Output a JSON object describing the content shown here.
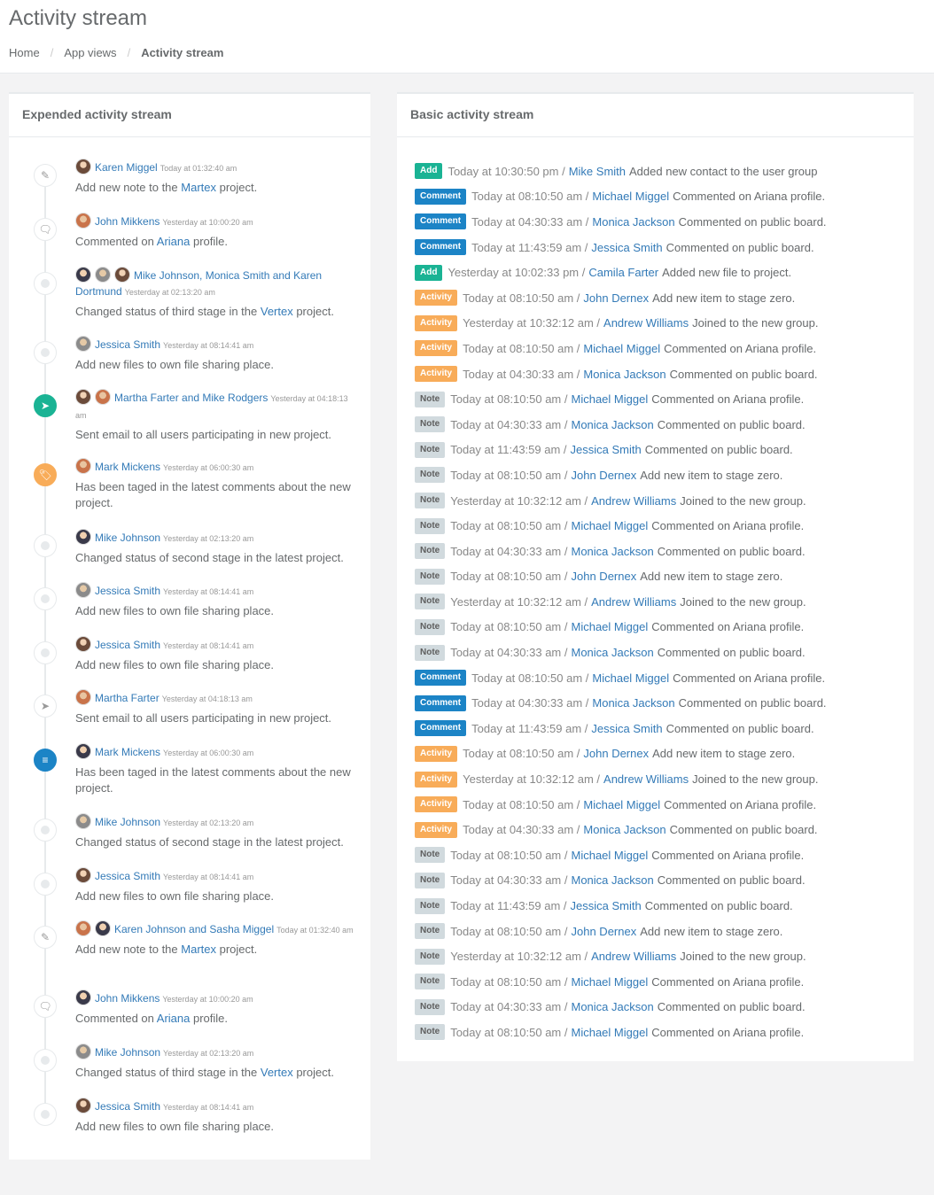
{
  "page": {
    "title": "Activity stream",
    "breadcrumb": [
      "Home",
      "App views",
      "Activity stream"
    ]
  },
  "left_panel": {
    "title": "Expended activity stream",
    "items": [
      {
        "icon": "pencil-icon",
        "style": "plain",
        "names": "Karen Miggel",
        "time": "Today at 01:32:40 am",
        "pre": "Add new note to the ",
        "link": "Martex",
        "post": " project."
      },
      {
        "icon": "comment-icon",
        "style": "plain",
        "names": "John Mikkens",
        "time": "Yesterday at 10:00:20 am",
        "pre": "Commented on ",
        "link": "Ariana",
        "post": " profile."
      },
      {
        "icon": "dot-icon",
        "style": "dot",
        "names": "Mike Johnson, Monica Smith and Karen Dortmund",
        "time": "Yesterday at 02:13:20 am",
        "pre": "Changed status of third stage in the ",
        "link": "Vertex",
        "post": " project."
      },
      {
        "icon": "dot-icon",
        "style": "dot",
        "names": "Jessica Smith",
        "time": "Yesterday at 08:14:41 am",
        "pre": "Add new files to own file sharing place.",
        "link": "",
        "post": ""
      },
      {
        "icon": "paper-plane-icon",
        "style": "green",
        "names": "Martha Farter and Mike Rodgers",
        "time": "Yesterday at 04:18:13 am",
        "pre": "Sent email to all users participating in new project.",
        "link": "",
        "post": ""
      },
      {
        "icon": "tag-icon",
        "style": "orange",
        "names": "Mark Mickens",
        "time": "Yesterday at 06:00:30 am",
        "pre": "Has been taged in the latest comments about the new project.",
        "link": "",
        "post": ""
      },
      {
        "icon": "dot-icon",
        "style": "dot",
        "names": "Mike Johnson",
        "time": "Yesterday at 02:13:20 am",
        "pre": "Changed status of second stage in the latest project.",
        "link": "",
        "post": ""
      },
      {
        "icon": "dot-icon",
        "style": "dot",
        "names": "Jessica Smith",
        "time": "Yesterday at 08:14:41 am",
        "pre": "Add new files to own file sharing place.",
        "link": "",
        "post": ""
      },
      {
        "icon": "dot-icon",
        "style": "dot",
        "names": "Jessica Smith",
        "time": "Yesterday at 08:14:41 am",
        "pre": "Add new files to own file sharing place.",
        "link": "",
        "post": ""
      },
      {
        "icon": "paper-plane-icon",
        "style": "plain",
        "names": "Martha Farter",
        "time": "Yesterday at 04:18:13 am",
        "pre": "Sent email to all users participating in new project.",
        "link": "",
        "post": ""
      },
      {
        "icon": "sliders-icon",
        "style": "blue",
        "names": "Mark Mickens",
        "time": "Yesterday at 06:00:30 am",
        "pre": "Has been taged in the latest comments about the new project.",
        "link": "",
        "post": ""
      },
      {
        "icon": "dot-icon",
        "style": "dot",
        "names": "Mike Johnson",
        "time": "Yesterday at 02:13:20 am",
        "pre": "Changed status of second stage in the latest project.",
        "link": "",
        "post": ""
      },
      {
        "icon": "dot-icon",
        "style": "dot",
        "names": "Jessica Smith",
        "time": "Yesterday at 08:14:41 am",
        "pre": "Add new files to own file sharing place.",
        "link": "",
        "post": ""
      },
      {
        "icon": "pencil-icon",
        "style": "plain",
        "names": "Karen Johnson and Sasha Miggel",
        "time": "Today at 01:32:40 am",
        "pre": "Add new note to the ",
        "link": "Martex",
        "post": " project."
      },
      {
        "icon": "comment-icon",
        "style": "plain",
        "names": "John Mikkens",
        "time": "Yesterday at 10:00:20 am",
        "pre": "Commented on ",
        "link": "Ariana",
        "post": " profile."
      },
      {
        "icon": "dot-icon",
        "style": "dot",
        "names": "Mike Johnson",
        "time": "Yesterday at 02:13:20 am",
        "pre": "Changed status of third stage in the ",
        "link": "Vertex",
        "post": " project."
      },
      {
        "icon": "dot-icon",
        "style": "dot",
        "names": "Jessica Smith",
        "time": "Yesterday at 08:14:41 am",
        "pre": "Add new files to own file sharing place.",
        "link": "",
        "post": ""
      }
    ]
  },
  "right_panel": {
    "title": "Basic activity stream",
    "rows": [
      {
        "badge": "Add",
        "type": "add",
        "time": "Today at 10:30:50 pm /",
        "who": "Mike Smith",
        "act": "Added new contact to the user group"
      },
      {
        "badge": "Comment",
        "type": "comment",
        "time": "Today at 08:10:50 am /",
        "who": "Michael Miggel",
        "act": "Commented on Ariana profile."
      },
      {
        "badge": "Comment",
        "type": "comment",
        "time": "Today at 04:30:33 am /",
        "who": "Monica Jackson",
        "act": "Commented on public board."
      },
      {
        "badge": "Comment",
        "type": "comment",
        "time": "Today at 11:43:59 am /",
        "who": "Jessica Smith",
        "act": "Commented on public board."
      },
      {
        "badge": "Add",
        "type": "add",
        "time": "Yesterday at 10:02:33 pm /",
        "who": "Camila Farter",
        "act": "Added new file to project."
      },
      {
        "badge": "Activity",
        "type": "activity",
        "time": "Today at 08:10:50 am /",
        "who": "John Dernex",
        "act": "Add new item to stage zero."
      },
      {
        "badge": "Activity",
        "type": "activity",
        "time": "Yesterday at 10:32:12 am /",
        "who": "Andrew Williams",
        "act": "Joined to the new group."
      },
      {
        "badge": "Activity",
        "type": "activity",
        "time": "Today at 08:10:50 am /",
        "who": "Michael Miggel",
        "act": "Commented on Ariana profile."
      },
      {
        "badge": "Activity",
        "type": "activity",
        "time": "Today at 04:30:33 am /",
        "who": "Monica Jackson",
        "act": "Commented on public board."
      },
      {
        "badge": "Note",
        "type": "note",
        "time": "Today at 08:10:50 am /",
        "who": "Michael Miggel",
        "act": "Commented on Ariana profile."
      },
      {
        "badge": "Note",
        "type": "note",
        "time": "Today at 04:30:33 am /",
        "who": "Monica Jackson",
        "act": "Commented on public board."
      },
      {
        "badge": "Note",
        "type": "note",
        "time": "Today at 11:43:59 am /",
        "who": "Jessica Smith",
        "act": "Commented on public board."
      },
      {
        "badge": "Note",
        "type": "note",
        "time": "Today at 08:10:50 am /",
        "who": "John Dernex",
        "act": "Add new item to stage zero."
      },
      {
        "badge": "Note",
        "type": "note",
        "time": "Yesterday at 10:32:12 am /",
        "who": "Andrew Williams",
        "act": "Joined to the new group."
      },
      {
        "badge": "Note",
        "type": "note",
        "time": "Today at 08:10:50 am /",
        "who": "Michael Miggel",
        "act": "Commented on Ariana profile."
      },
      {
        "badge": "Note",
        "type": "note",
        "time": "Today at 04:30:33 am /",
        "who": "Monica Jackson",
        "act": "Commented on public board."
      },
      {
        "badge": "Note",
        "type": "note",
        "time": "Today at 08:10:50 am /",
        "who": "John Dernex",
        "act": "Add new item to stage zero."
      },
      {
        "badge": "Note",
        "type": "note",
        "time": "Yesterday at 10:32:12 am /",
        "who": "Andrew Williams",
        "act": "Joined to the new group."
      },
      {
        "badge": "Note",
        "type": "note",
        "time": "Today at 08:10:50 am /",
        "who": "Michael Miggel",
        "act": "Commented on Ariana profile."
      },
      {
        "badge": "Note",
        "type": "note",
        "time": "Today at 04:30:33 am /",
        "who": "Monica Jackson",
        "act": "Commented on public board."
      },
      {
        "badge": "Comment",
        "type": "comment",
        "time": "Today at 08:10:50 am /",
        "who": "Michael Miggel",
        "act": "Commented on Ariana profile."
      },
      {
        "badge": "Comment",
        "type": "comment",
        "time": "Today at 04:30:33 am /",
        "who": "Monica Jackson",
        "act": "Commented on public board."
      },
      {
        "badge": "Comment",
        "type": "comment",
        "time": "Today at 11:43:59 am /",
        "who": "Jessica Smith",
        "act": "Commented on public board."
      },
      {
        "badge": "Activity",
        "type": "activity",
        "time": "Today at 08:10:50 am /",
        "who": "John Dernex",
        "act": "Add new item to stage zero."
      },
      {
        "badge": "Activity",
        "type": "activity",
        "time": "Yesterday at 10:32:12 am /",
        "who": "Andrew Williams",
        "act": "Joined to the new group."
      },
      {
        "badge": "Activity",
        "type": "activity",
        "time": "Today at 08:10:50 am /",
        "who": "Michael Miggel",
        "act": "Commented on Ariana profile."
      },
      {
        "badge": "Activity",
        "type": "activity",
        "time": "Today at 04:30:33 am /",
        "who": "Monica Jackson",
        "act": "Commented on public board."
      },
      {
        "badge": "Note",
        "type": "note",
        "time": "Today at 08:10:50 am /",
        "who": "Michael Miggel",
        "act": "Commented on Ariana profile."
      },
      {
        "badge": "Note",
        "type": "note",
        "time": "Today at 04:30:33 am /",
        "who": "Monica Jackson",
        "act": "Commented on public board."
      },
      {
        "badge": "Note",
        "type": "note",
        "time": "Today at 11:43:59 am /",
        "who": "Jessica Smith",
        "act": "Commented on public board."
      },
      {
        "badge": "Note",
        "type": "note",
        "time": "Today at 08:10:50 am /",
        "who": "John Dernex",
        "act": "Add new item to stage zero."
      },
      {
        "badge": "Note",
        "type": "note",
        "time": "Yesterday at 10:32:12 am /",
        "who": "Andrew Williams",
        "act": "Joined to the new group."
      },
      {
        "badge": "Note",
        "type": "note",
        "time": "Today at 08:10:50 am /",
        "who": "Michael Miggel",
        "act": "Commented on Ariana profile."
      },
      {
        "badge": "Note",
        "type": "note",
        "time": "Today at 04:30:33 am /",
        "who": "Monica Jackson",
        "act": "Commented on public board."
      },
      {
        "badge": "Note",
        "type": "note",
        "time": "Today at 08:10:50 am /",
        "who": "Michael Miggel",
        "act": "Commented on Ariana profile."
      }
    ]
  }
}
